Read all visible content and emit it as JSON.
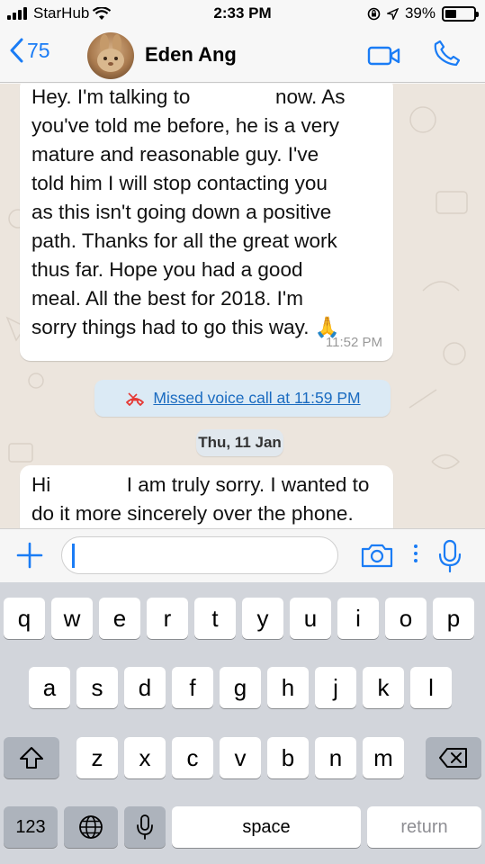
{
  "status_bar": {
    "carrier": "StarHub",
    "time": "2:33 PM",
    "battery": "39%",
    "battery_level": 0.39
  },
  "header": {
    "back_count": "75",
    "contact_name": "Eden Ang"
  },
  "messages": [
    {
      "lines": [
        "Hey. I'm talking to ████████ now. As",
        "you've told me before, he is a very",
        "mature and reasonable guy. I've",
        "told him I will stop contacting you",
        "as this isn't going down a positive",
        "path. Thanks for all the great work",
        "thus far. Hope you had a good",
        "meal. All the best for 2018. I'm",
        "sorry things had to go this way. 🙏"
      ],
      "time": "11:52 PM"
    },
    {
      "lines": [
        "Hi ████████ I am truly sorry. I wanted to",
        "do it more sincerely over the phone."
      ]
    }
  ],
  "system_message": "Missed voice call at 11:59 PM",
  "date_divider": "Thu, 11 Jan",
  "input": {
    "value": "",
    "placeholder": ""
  },
  "keyboard": {
    "row1": [
      "q",
      "w",
      "e",
      "r",
      "t",
      "y",
      "u",
      "i",
      "o",
      "p"
    ],
    "row2": [
      "a",
      "s",
      "d",
      "f",
      "g",
      "h",
      "j",
      "k",
      "l"
    ],
    "row3": [
      "z",
      "x",
      "c",
      "v",
      "b",
      "n",
      "m"
    ],
    "numbers": "123",
    "space": "space",
    "return": "return"
  },
  "colors": {
    "accent": "#1a7cf5",
    "chat_background": "#ece5dd",
    "missed_call": "#e53935"
  }
}
